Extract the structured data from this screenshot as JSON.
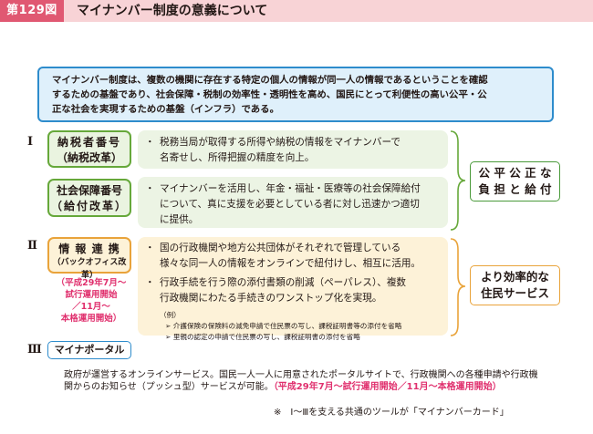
{
  "header": {
    "figure_number": "第129図",
    "title": "マイナンバー制度の意義について"
  },
  "intro": {
    "lines": [
      "マイナンバー制度は、複数の機関に存在する特定の個人の情報が同一人の情報であるということを確認",
      "するための基盤であり、社会保障・税制の効率性・透明性を高め、国民にとって利便性の高い公平・公",
      "正な社会を実現するための基盤（インフラ）である。"
    ]
  },
  "section1": {
    "numeral": "Ⅰ",
    "tax_label": {
      "line1": "納税者番号",
      "line2": "（納税改革）"
    },
    "tax_bullets": [
      "税務当局が取得する所得や納税の情報をマイナンバーで",
      "名寄せし、所得把握の精度を向上。"
    ],
    "welfare_label": {
      "line1": "社会保障番号",
      "line2": "（給付改革）"
    },
    "welfare_bullets": [
      "マイナンバーを活用し、年金・福祉・医療等の社会保障給付",
      "について、真に支援を必要としている者に対し迅速かつ適切",
      "に提供。"
    ],
    "result": {
      "line1": "公 平 公 正 な",
      "line2": "負 担 と 給 付"
    }
  },
  "section2": {
    "numeral": "Ⅱ",
    "label": {
      "line1": "情 報 連 携",
      "line2": "（バックオフィス改革）"
    },
    "schedule": [
      "（平成29年7月～",
      "試行運用開始",
      "／11月～",
      "本格運用開始）"
    ],
    "bullet1": [
      "国の行政機関や地方公共団体がそれぞれで管理している",
      "様々な同一人の情報をオンラインで紐付けし、相互に活用。"
    ],
    "bullet2": [
      "行政手続を行う際の添付書類の削減（ペーパレス）、複数",
      "行政機関にわたる手続きのワンストップ化を実現。"
    ],
    "example_label": "（例）",
    "examples": [
      "➢ 介護保険の保険料の減免申請で住民票の写し、課税証明書等の添付を省略",
      "➢ 里親の認定の申請で住民票の写し、課税証明書の添付を省略"
    ],
    "result": {
      "line1": "より効率的な",
      "line2": "住民サービス"
    }
  },
  "section3": {
    "numeral": "Ⅲ",
    "label": "マイナポータル",
    "desc_line1": "政府が運営するオンラインサービス。国民一人一人に用意されたポータルサイトで、行政機関への各種申請や行政機",
    "desc_line2_plain": "関からのお知らせ（プッシュ型）サービスが可能。",
    "desc_line2_red": "（平成29年7月～試行運用開始／11月～本格運用開始）"
  },
  "footnote": "※　Ⅰ～Ⅲを支える共通のツールが「マイナンバーカード」",
  "colors": {
    "header_bg": "#f8d3d6",
    "badge": "#e05872",
    "intro_border": "#2e8ccc",
    "green_border": "#66a83a",
    "orange_border": "#e9a33a",
    "schedule_red": "#e0306e"
  }
}
